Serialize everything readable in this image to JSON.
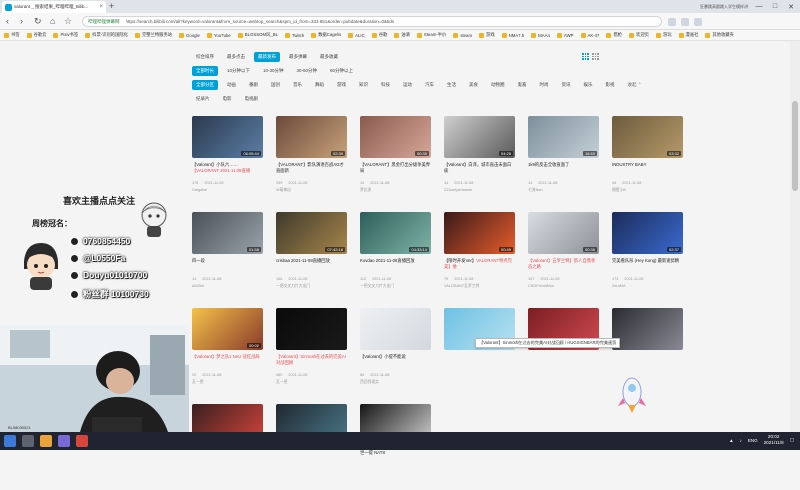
{
  "browser": {
    "tab_title": "valorant _ 搜索结果_哔哩哔哩_Bilib...",
    "site_label": "哔哩哔哩弹幕网",
    "url": "https://search.bilibili.com/all?keyword=valorant&from_source=webtop_search&spm_id_from=333.851&order=pubdate&duration=0&tids",
    "right_label": "狂暴跳高跟跳入学生模样讲",
    "win_controls": [
      "—",
      "□",
      "✕"
    ]
  },
  "bookmarks": [
    "书签",
    "谷歌云",
    "Pixiv书签",
    "抖票-识别的国际化",
    "完整兰特服务站",
    "Google",
    "YouTube",
    "BLOSSOM风_BL",
    "Twitch",
    "数据Cagelis",
    "ALIC",
    "谷歌",
    "油滴",
    "Steam-半价",
    "steam",
    "游戏",
    "NMA7.5",
    "MAA4",
    "AWP",
    "AK-47",
    "猎枪",
    "欢迎页",
    "游玩",
    "漫画社",
    "其他收藏夹"
  ],
  "filters": {
    "order": [
      {
        "label": "综合排序",
        "active": false
      },
      {
        "label": "最多点击",
        "active": false
      },
      {
        "label": "最新发布",
        "active": true
      },
      {
        "label": "最多弹幕",
        "active": false
      },
      {
        "label": "最多收藏",
        "active": false
      }
    ],
    "duration": [
      {
        "label": "全部时长",
        "active": true
      },
      {
        "label": "10分钟以下",
        "active": false
      },
      {
        "label": "10-30分钟",
        "active": false
      },
      {
        "label": "30-60分钟",
        "active": false
      },
      {
        "label": "60分钟以上",
        "active": false
      }
    ],
    "partitions": [
      {
        "label": "全部分区",
        "active": true
      },
      {
        "label": "动画",
        "active": false
      },
      {
        "label": "番剧",
        "active": false
      },
      {
        "label": "国创",
        "active": false
      },
      {
        "label": "音乐",
        "active": false
      },
      {
        "label": "舞蹈",
        "active": false
      },
      {
        "label": "游戏",
        "active": false
      },
      {
        "label": "知识",
        "active": false
      },
      {
        "label": "科技",
        "active": false
      },
      {
        "label": "运动",
        "active": false
      },
      {
        "label": "汽车",
        "active": false
      },
      {
        "label": "生活",
        "active": false
      },
      {
        "label": "美食",
        "active": false
      },
      {
        "label": "动物圈",
        "active": false
      },
      {
        "label": "鬼畜",
        "active": false
      },
      {
        "label": "时尚",
        "active": false
      },
      {
        "label": "资讯",
        "active": false
      },
      {
        "label": "娱乐",
        "active": false
      },
      {
        "label": "影视",
        "active": false
      }
    ],
    "partitions2": [
      {
        "label": "纪录片",
        "active": false
      },
      {
        "label": "电影",
        "active": false
      },
      {
        "label": "电视剧",
        "active": false
      }
    ],
    "collapse_label": "收起 ⌃"
  },
  "videos": [
    {
      "duration": "06:05:44",
      "title": "【Valorant】小队六……",
      "title_hl": "【VALORANT 2021.11.08直播",
      "views": "176",
      "date": "2021-11-08",
      "uploader": "Gaigalse",
      "colors": [
        "#2b3a4e",
        "#5b7ea6"
      ]
    },
    {
      "duration": "02:39",
      "title": "【VALORANT】影队演进百战AG才直面新",
      "title_hl": "",
      "views": "259",
      "date": "2021-11-08",
      "uploader": "W萌神出",
      "colors": [
        "#6b4a3a",
        "#c7a27a"
      ]
    },
    {
      "duration": "00:35",
      "title": "【VALORANT】黑金打出分级争美界局",
      "title_hl": "",
      "views": "15",
      "date": "2021-11-08",
      "uploader": "罗比多",
      "colors": [
        "#8a5a4e",
        "#d7a89a"
      ]
    },
    {
      "duration": "04:28",
      "title": "【Valorant】白泽，城市直击未面白疵",
      "title_hl": "",
      "views": "14",
      "date": "2021-11-08",
      "uploader": "ZZUsetpimiaarte",
      "colors": [
        "#cfcfcf",
        "#5a5a5a"
      ]
    },
    {
      "duration": "16:53",
      "title": "1k9的反击全收直面了",
      "title_hl": "",
      "views": "14",
      "date": "2021-11-08",
      "uploader": "七流Nen",
      "colors": [
        "#7d8f9c",
        "#c5d0d6"
      ]
    },
    {
      "duration": "03:32",
      "title": "INDUSTRY BABY",
      "title_hl": "",
      "views": "45",
      "date": "2021-11-08",
      "uploader": "隔壁小B",
      "colors": [
        "#6c5b3e",
        "#b69a68"
      ]
    },
    {
      "duration": "01:58",
      "title": "四一段",
      "title_hl": "",
      "views": "14",
      "date": "2021-11-08",
      "uploader": "AMZek",
      "colors": [
        "#4a5058",
        "#9aa3ab"
      ]
    },
    {
      "duration": "07:42:18",
      "title": "crisbaa 2021-11-08直播回放",
      "title_hl": "",
      "views": "166",
      "date": "2021-11-08",
      "uploader": "一把交叉刀片大出门",
      "colors": [
        "#3e3a2e",
        "#a8864a"
      ]
    },
    {
      "duration": "04:33:14",
      "title": "Kovdao 2021-11-08直播回放",
      "title_hl": "",
      "views": "112",
      "date": "2021-11-08",
      "uploader": "一把交叉刀片大出门",
      "colors": [
        "#2f5e5a",
        "#7fb4a8"
      ]
    },
    {
      "duration": "00:49",
      "title": "【限时开发Ver】",
      "title_hl": "VALORANT特点完美】维",
      "views": "79",
      "date": "2021-11-08",
      "uploader": "VALORANT瓦罗兰特",
      "colors": [
        "#3a1a1a",
        "#e85c2c"
      ]
    },
    {
      "duration": "00:36",
      "title": "",
      "title_hl": "【Valorant】五罗兰特】新人自我状态之路",
      "views": "107",
      "date": "2021-11-08",
      "uploader": "CSGFIenstMos",
      "colors": [
        "#d9dde2",
        "#8c9098"
      ]
    },
    {
      "duration": "02:37",
      "title": "完美看队形 (Hey Kong) 最新速剪精",
      "title_hl": "",
      "views": "173",
      "date": "2021-11-08",
      "uploader": "ZeraMA",
      "colors": [
        "#1c2c5a",
        "#3a6ad0"
      ]
    },
    {
      "duration": "00:02",
      "title": "",
      "title_hl": "【Valorant】梦之队1 NeU 冠红战局",
      "views": "20",
      "date": "2021-11-08",
      "uploader": "瓦一把",
      "colors": [
        "#f3c24a",
        "#8a3a2a"
      ]
    },
    {
      "duration": "",
      "title": "",
      "title_hl": "【Valorant】Sinmoth在过去的完美AI对战回顾",
      "views": "480",
      "date": "2021-11-08",
      "uploader": "瓦一把",
      "colors": [
        "#0a0a0a",
        "#1a1a1a"
      ]
    },
    {
      "duration": "",
      "title": "【Valorant】小提不能说",
      "title_hl": "",
      "views": "85",
      "date": "2021-11-08",
      "uploader": "西回到现实",
      "colors": [
        "#eef0f3",
        "#d4d8de"
      ]
    },
    {
      "duration": "",
      "title": "",
      "title_hl": "",
      "views": "",
      "date": "",
      "uploader": "",
      "colors": [
        "#6ec1e4",
        "#b7e1f0"
      ]
    },
    {
      "duration": "",
      "title": "",
      "title_hl": "",
      "views": "",
      "date": "",
      "uploader": "",
      "colors": [
        "#7a1e24",
        "#d04a50"
      ]
    },
    {
      "duration": "",
      "title": "",
      "title_hl": "",
      "views": "",
      "date": "",
      "uploader": "",
      "colors": [
        "#2a2a30",
        "#8a8a96"
      ]
    },
    {
      "duration": "",
      "title": "",
      "title_hl": "",
      "views": "",
      "date": "",
      "uploader": "",
      "colors": [
        "#3a2020",
        "#d5453c"
      ]
    },
    {
      "duration": "",
      "title": "",
      "title_hl": "",
      "views": "",
      "date": "",
      "uploader": "",
      "colors": [
        "#202830",
        "#4a7a8a"
      ]
    },
    {
      "duration": "",
      "title": "世一提 NATS",
      "title_hl": "",
      "views": "",
      "date": "",
      "uploader": "",
      "colors": [
        "#161616",
        "#d4d4d4"
      ]
    }
  ],
  "tooltip": "【Valorant】Sinmoth在过去的完美AI对战回顾 / HUGSIGNBAR的完美速剪",
  "overlay": {
    "title": "喜欢主播点点关注",
    "subtitle": "周榜冠名：",
    "contacts": [
      {
        "icon": "qq",
        "text": "0760854450"
      },
      {
        "icon": "weibo",
        "text": "@L0550Fa"
      },
      {
        "icon": "douyin",
        "text": "Douyu01010700"
      },
      {
        "icon": "fans",
        "text": "粉丝群 10100730"
      }
    ]
  },
  "taskbar": {
    "lang": "ENG",
    "time": "20:02",
    "date": "2021/11/8"
  },
  "status_corner": "BL08030521"
}
